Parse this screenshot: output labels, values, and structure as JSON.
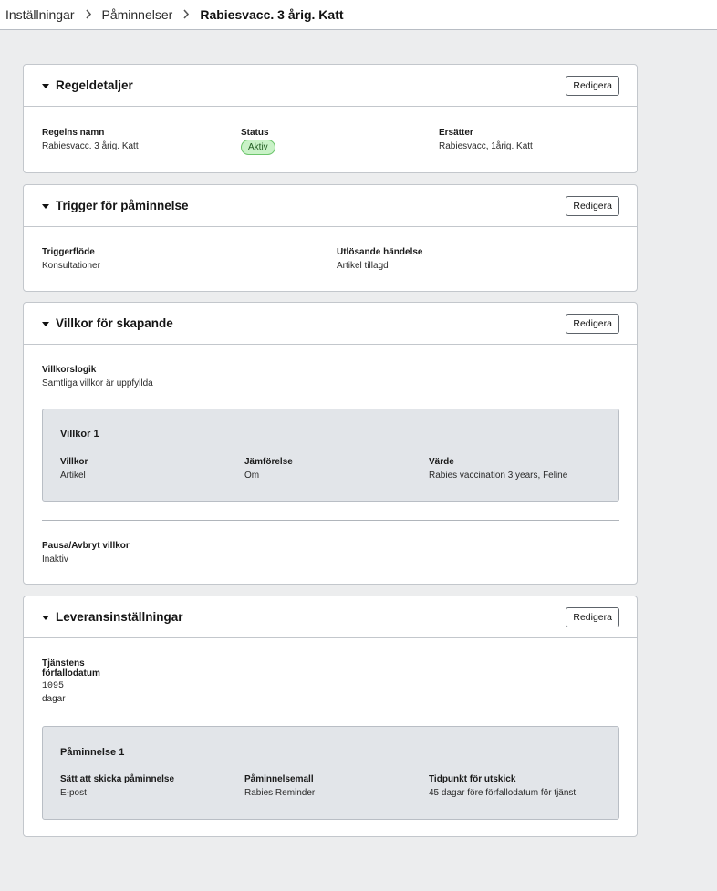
{
  "breadcrumb": {
    "items": [
      "Inställningar",
      "Påminnelser",
      "Rabiesvacc. 3 årig. Katt"
    ],
    "separator": ">"
  },
  "cards": {
    "rule_details": {
      "title": "Regeldetaljer",
      "edit_label": "Redigera",
      "rule_name_label": "Regelns namn",
      "rule_name_value": "Rabiesvacc. 3 årig. Katt",
      "status_label": "Status",
      "status_value": "Aktiv",
      "replaces_label": "Ersätter",
      "replaces_value": "Rabiesvacc, 1årig. Katt"
    },
    "trigger": {
      "title": "Trigger för påminnelse",
      "edit_label": "Redigera",
      "flow_label": "Triggerflöde",
      "flow_value": "Konsultationer",
      "event_label": "Utlösande händelse",
      "event_value": "Artikel tillagd"
    },
    "conditions": {
      "title": "Villkor för skapande",
      "edit_label": "Redigera",
      "logic_label": "Villkorslogik",
      "logic_value": "Samtliga villkor är uppfyllda",
      "condition_1": {
        "title": "Villkor 1",
        "condition_label": "Villkor",
        "condition_value": "Artikel",
        "comparison_label": "Jämförelse",
        "comparison_value": "Om",
        "value_label": "Värde",
        "value_value": "Rabies vaccination 3 years, Feline"
      },
      "pause_label": "Pausa/Avbryt villkor",
      "pause_value": "Inaktiv"
    },
    "delivery": {
      "title": "Leveransinställningar",
      "edit_label": "Redigera",
      "due_label_line1": "Tjänstens",
      "due_label_line2": "förfallodatum",
      "due_value": "1095",
      "due_unit": "dagar",
      "reminder_1": {
        "title": "Påminnelse 1",
        "method_label": "Sätt att skicka påminnelse",
        "method_value": "E-post",
        "template_label": "Påminnelsemall",
        "template_value": "Rabies Reminder",
        "timing_label": "Tidpunkt för utskick",
        "timing_value": "45 dagar före förfallodatum för tjänst"
      }
    }
  },
  "colors": {
    "status_active_bg": "#c9f2c7",
    "status_active_border": "#6cc56c",
    "page_bg": "#ecedee",
    "inner_panel_bg": "#e2e5e9"
  }
}
